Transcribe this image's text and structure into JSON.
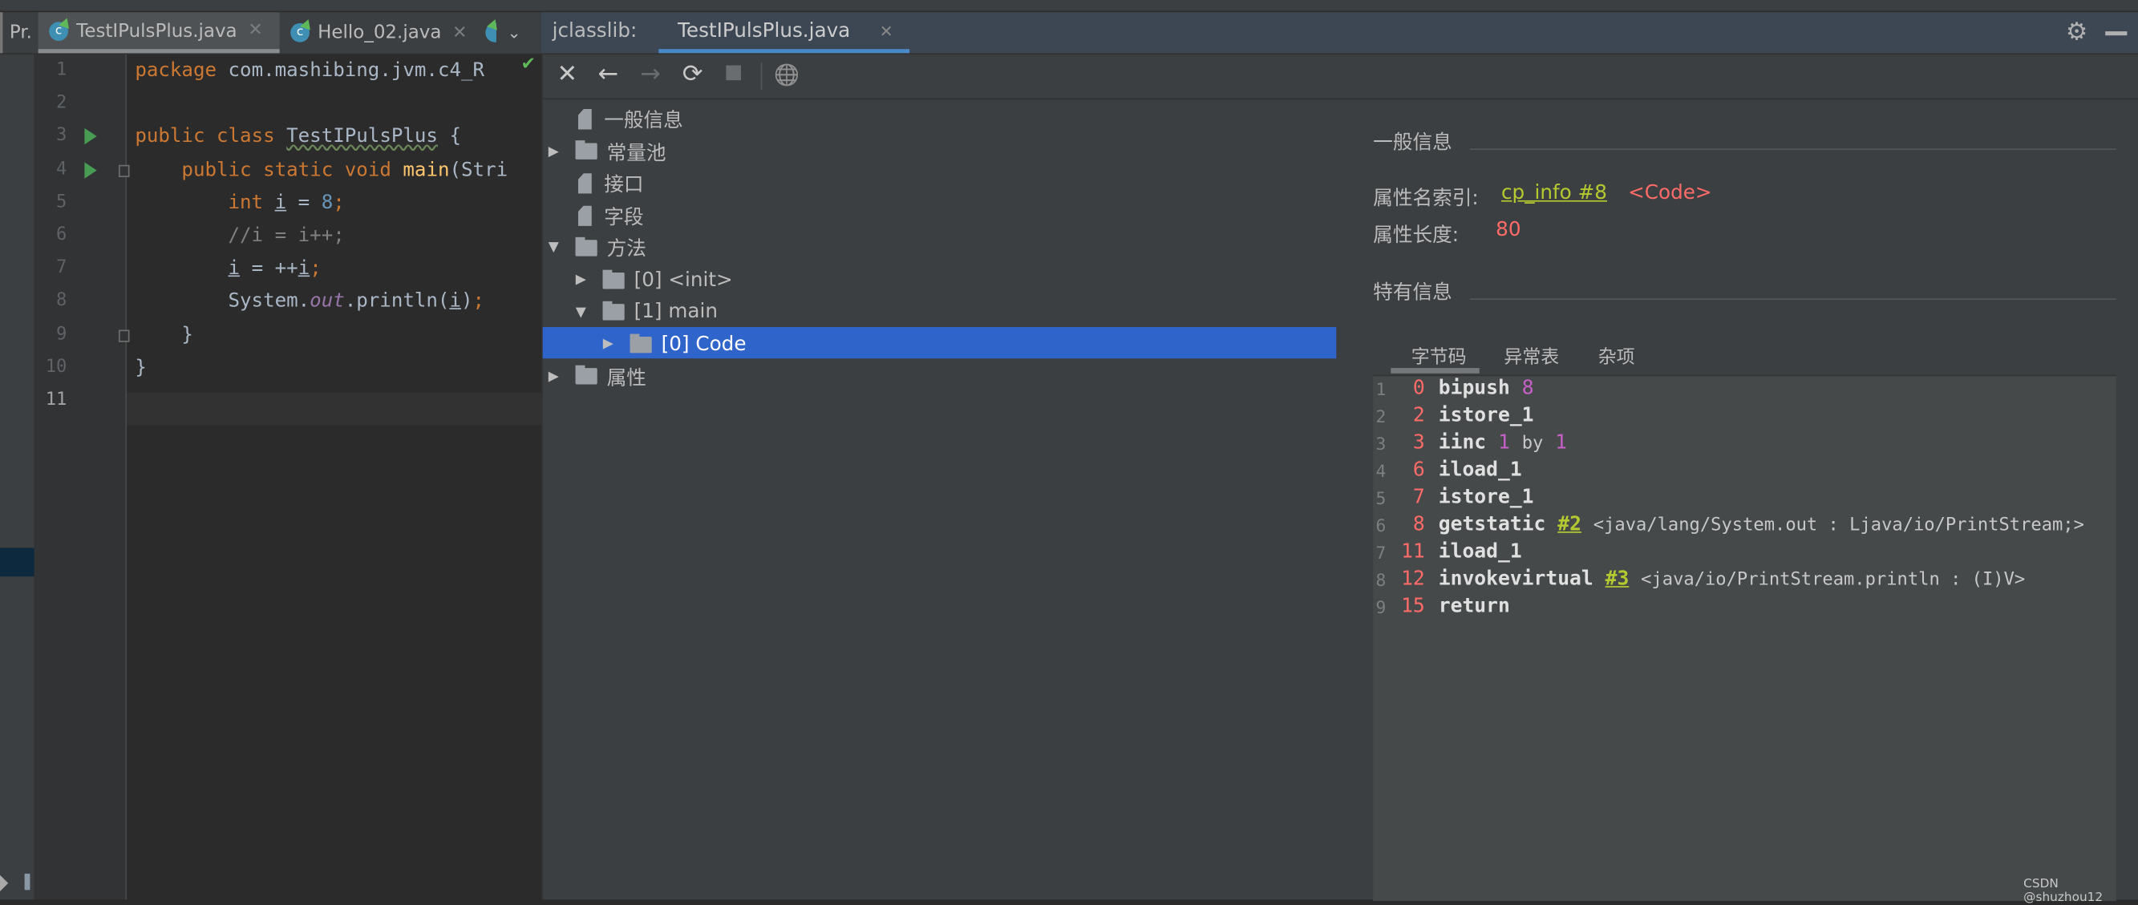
{
  "editor": {
    "tabs": [
      {
        "label": "Pr.",
        "partial": true
      },
      {
        "label": "TestIPulsPlus.java",
        "active": true
      },
      {
        "label": "Hello_02.java"
      }
    ],
    "current_line": 11,
    "lines": [
      [
        [
          "package ",
          "keyword"
        ],
        [
          "com.mashibing.jvm.c4_R",
          "ident"
        ]
      ],
      [],
      [
        [
          "public ",
          "keyword"
        ],
        [
          "class ",
          "keyword"
        ],
        [
          "TestIPulsPlus",
          "warn"
        ],
        [
          " {",
          "ident"
        ]
      ],
      [
        [
          "    public ",
          "keyword"
        ],
        [
          "static ",
          "keyword"
        ],
        [
          "void ",
          "keyword"
        ],
        [
          "main",
          "method"
        ],
        [
          "(Stri",
          "ident"
        ]
      ],
      [
        [
          "        int ",
          "keyword"
        ],
        [
          "i",
          "local"
        ],
        [
          " = ",
          "ident"
        ],
        [
          "8",
          "number"
        ],
        [
          ";",
          "punct"
        ]
      ],
      [
        [
          "        //i = i++;",
          "comment"
        ]
      ],
      [
        [
          "        ",
          "ident"
        ],
        [
          "i",
          "local"
        ],
        [
          " = ++",
          "ident"
        ],
        [
          "i",
          "local"
        ],
        [
          ";",
          "punct"
        ]
      ],
      [
        [
          "        System.",
          "ident"
        ],
        [
          "out",
          "field"
        ],
        [
          ".println(",
          "ident"
        ],
        [
          "i",
          "local"
        ],
        [
          ")",
          "ident"
        ],
        [
          ";",
          "punct"
        ]
      ],
      [
        [
          "    }",
          "ident"
        ]
      ],
      [
        [
          "}",
          "ident"
        ]
      ],
      []
    ],
    "run_lines": [
      3,
      4
    ],
    "fold_lines": [
      4,
      9
    ]
  },
  "jclasslib": {
    "header_label": "jclasslib:",
    "tab_label": "TestIPulsPlus.java",
    "toolbar": [
      {
        "icon": "close-icon",
        "glyph": "✕"
      },
      {
        "icon": "back-icon",
        "glyph": "←"
      },
      {
        "icon": "forward-icon",
        "glyph": "→"
      },
      {
        "icon": "refresh-icon",
        "glyph": "⟳"
      },
      {
        "icon": "save-icon",
        "glyph": "▪"
      },
      {
        "icon": "globe-icon",
        "glyph": "🌐"
      }
    ],
    "tree": [
      {
        "label": "一般信息",
        "level": 0,
        "type": "file",
        "arrow": ""
      },
      {
        "label": "常量池",
        "level": 0,
        "type": "folder",
        "arrow": "▶"
      },
      {
        "label": "接口",
        "level": 0,
        "type": "file",
        "arrow": ""
      },
      {
        "label": "字段",
        "level": 0,
        "type": "file",
        "arrow": ""
      },
      {
        "label": "方法",
        "level": 0,
        "type": "folder",
        "arrow": "▼"
      },
      {
        "label": "[0] <init>",
        "level": 1,
        "type": "folder",
        "arrow": "▶"
      },
      {
        "label": "[1] main",
        "level": 1,
        "type": "folder",
        "arrow": "▼"
      },
      {
        "label": "[0] Code",
        "level": 2,
        "type": "folder",
        "arrow": "▶",
        "selected": true
      },
      {
        "label": "属性",
        "level": 0,
        "type": "folder",
        "arrow": "▶"
      }
    ],
    "detail": {
      "general_title": "一般信息",
      "name_index_label": "属性名索引:",
      "name_index_link": "cp_info #8",
      "name_index_value": "<Code>",
      "length_label": "属性长度:",
      "length_value": "80",
      "specific_title": "特有信息",
      "tabs": [
        "字节码",
        "异常表",
        "杂项"
      ],
      "active_tab": "字节码",
      "bytecode": [
        {
          "line": "1",
          "offset": "0",
          "op": "bipush",
          "args": [
            [
              "8",
              "barg"
            ]
          ]
        },
        {
          "line": "2",
          "offset": "2",
          "op": "istore_1",
          "args": []
        },
        {
          "line": "3",
          "offset": "3",
          "op": "iinc",
          "args": [
            [
              "1",
              "barg"
            ],
            [
              "by",
              "bcm"
            ],
            [
              "1",
              "barg"
            ]
          ]
        },
        {
          "line": "4",
          "offset": "6",
          "op": "iload_1",
          "args": []
        },
        {
          "line": "5",
          "offset": "7",
          "op": "istore_1",
          "args": []
        },
        {
          "line": "6",
          "offset": "8",
          "op": "getstatic",
          "args": [
            [
              "#2",
              "bref"
            ],
            [
              "<java/lang/System.out : Ljava/io/PrintStream;>",
              "bcm"
            ]
          ]
        },
        {
          "line": "7",
          "offset": "11",
          "op": "iload_1",
          "args": []
        },
        {
          "line": "8",
          "offset": "12",
          "op": "invokevirtual",
          "args": [
            [
              "#3",
              "bref"
            ],
            [
              "<java/io/PrintStream.println : (I)V>",
              "bcm"
            ]
          ]
        },
        {
          "line": "9",
          "offset": "15",
          "op": "return",
          "args": []
        }
      ]
    }
  },
  "watermark": "CSDN @shuzhou12",
  "colors": {
    "selection": "#2f65ca",
    "link": "#b5c930",
    "value": "#ff6b68",
    "keyword": "#cc7832"
  }
}
